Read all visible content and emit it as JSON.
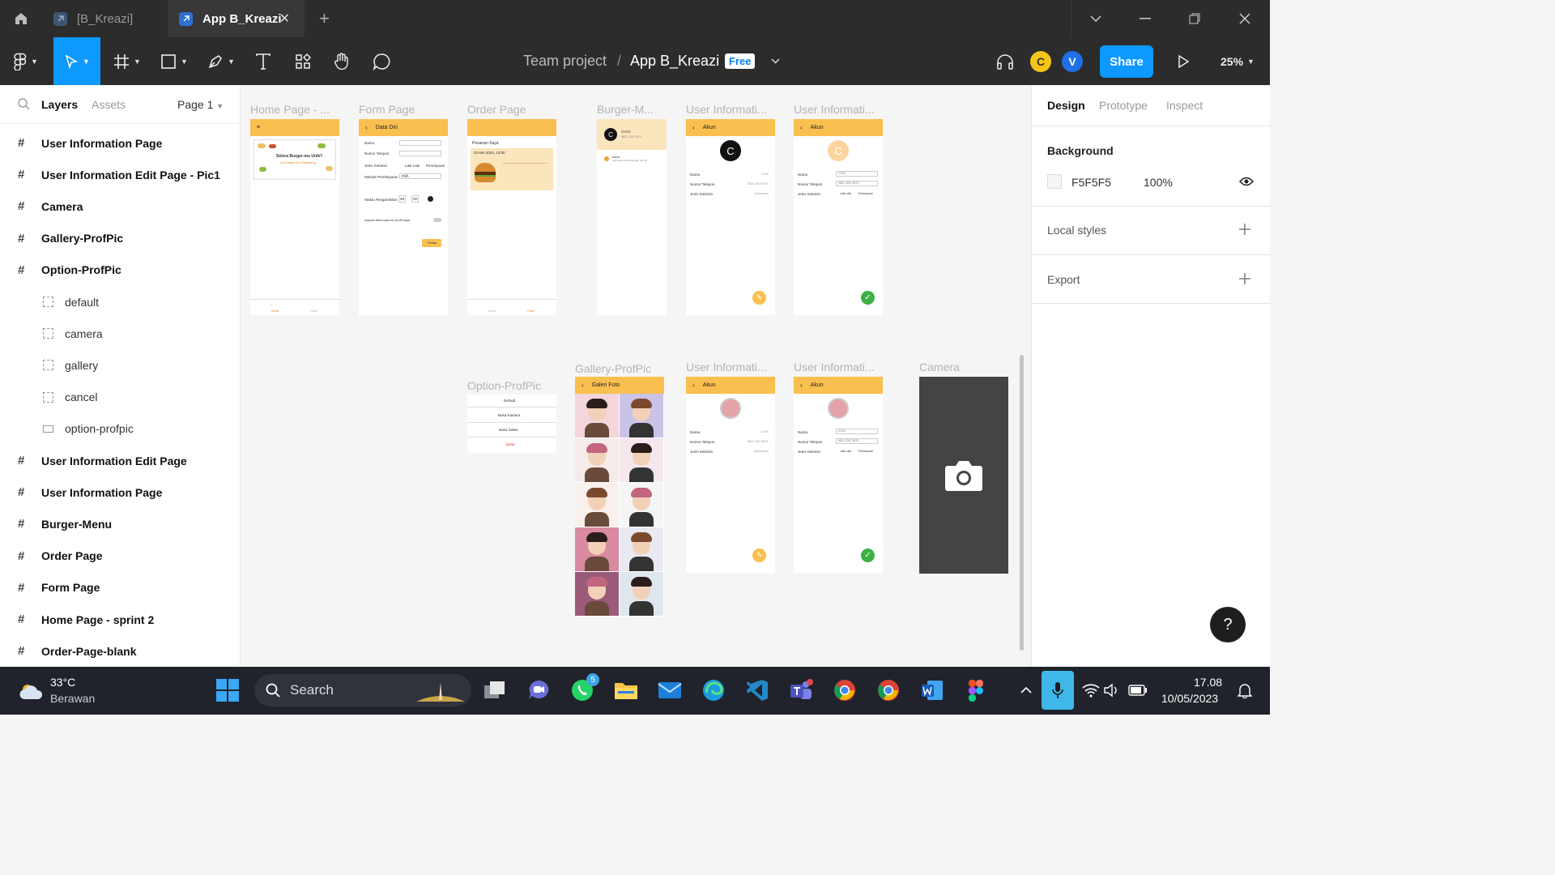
{
  "tabs": [
    {
      "label": "[B_Kreazi]",
      "active": false
    },
    {
      "label": "App B_Kreazi",
      "active": true
    }
  ],
  "toolbar": {
    "project": "Team project",
    "separator": "/",
    "file": "App B_Kreazi",
    "plan_badge": "Free",
    "avatars": [
      {
        "letter": "C",
        "color": "#f5c518"
      },
      {
        "letter": "V",
        "color": "#1f6fe5"
      }
    ],
    "share_label": "Share",
    "zoom": "25%",
    "accent": "#0d99ff"
  },
  "left_panel": {
    "tabs": [
      "Layers",
      "Assets"
    ],
    "page": "Page 1",
    "layers": [
      {
        "name": "User Information Page",
        "type": "frame"
      },
      {
        "name": "User Information Edit Page - Pic1",
        "type": "frame"
      },
      {
        "name": "Camera",
        "type": "frame"
      },
      {
        "name": "Gallery-ProfPic",
        "type": "frame"
      },
      {
        "name": "Option-ProfPic",
        "type": "frame"
      },
      {
        "name": "default",
        "type": "child"
      },
      {
        "name": "camera",
        "type": "child"
      },
      {
        "name": "gallery",
        "type": "child"
      },
      {
        "name": "cancel",
        "type": "child"
      },
      {
        "name": "option-profpic",
        "type": "rect"
      },
      {
        "name": "User Information Edit Page",
        "type": "frame"
      },
      {
        "name": "User Information Page",
        "type": "frame"
      },
      {
        "name": "Burger-Menu",
        "type": "frame"
      },
      {
        "name": "Order Page",
        "type": "frame"
      },
      {
        "name": "Form Page",
        "type": "frame"
      },
      {
        "name": "Home Page - sprint 2",
        "type": "frame"
      },
      {
        "name": "Order-Page-blank",
        "type": "frame"
      }
    ]
  },
  "canvas": {
    "frame_labels": {
      "home": "Home Page - ...",
      "form": "Form Page",
      "order": "Order Page",
      "burger": "Burger-M...",
      "user1": "User Informati...",
      "user2": "User Informati...",
      "option": "Option-ProfPic",
      "gallery": "Gallery-ProfPic",
      "user3": "User Informati...",
      "user4": "User Informati...",
      "camera": "Camera"
    },
    "form": {
      "header": "Data Diri",
      "fields": [
        "Nama",
        "Nomor Telepon",
        "Jenis Kelamin",
        "Metode Pembayaran",
        "Waktu Pengambilan"
      ],
      "gender_opts": [
        "Laki-Laki",
        "Perempuan"
      ],
      "payment": "Pilih",
      "hour": "09",
      "minute": "00",
      "toggle_text": "simpan data saya ke profil saya",
      "submit": "Pesan"
    },
    "home": {
      "banner_line1": "Selera Burger-mu Unik?",
      "banner_line2": "Yuk Pesan kue Sekarang",
      "nav": [
        "Home",
        "Order"
      ]
    },
    "order": {
      "title": "Pesanan Saya",
      "date": "03 Mei 2023, 13:00",
      "nav": [
        "Home",
        "Order"
      ]
    },
    "burger": {
      "name": "CIVIC",
      "phone": "0821 3247 8573",
      "menu_item": "Akun",
      "menu_sub": "Informasi pribadi dengan foto dll"
    },
    "user": {
      "header": "Akun",
      "labels": [
        "Nama",
        "Nomor Telepon",
        "Jenis Kelamin"
      ],
      "values": [
        "CIVIC",
        "0821 3247 8573",
        "perempuan"
      ],
      "avatar_letter": "C"
    },
    "option": {
      "items": [
        "Default",
        "Buka Kamera",
        "Buka Galeri",
        "Batal"
      ],
      "cancel_color": "#e53935"
    },
    "gallery": {
      "header": "Galeri Foto"
    },
    "header_color": "#f9bf4f"
  },
  "right_panel": {
    "tabs": [
      "Design",
      "Prototype",
      "Inspect"
    ],
    "background_label": "Background",
    "bg_hex": "F5F5F5",
    "bg_opacity": "100%",
    "local_styles": "Local styles",
    "export": "Export",
    "help": "?"
  },
  "taskbar": {
    "temp": "33°C",
    "weather": "Berawan",
    "search": "Search",
    "whatsapp_badge": "5",
    "time": "17.08",
    "date": "10/05/2023"
  }
}
